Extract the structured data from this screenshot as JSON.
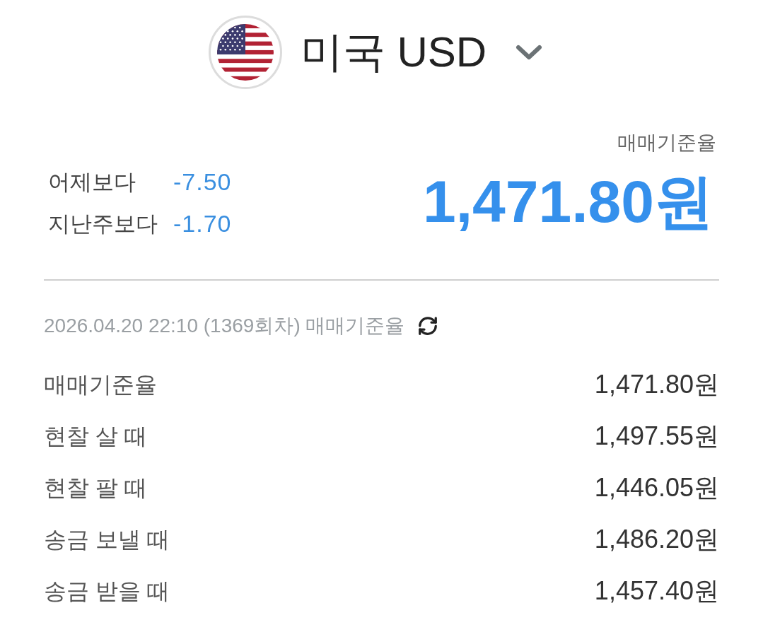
{
  "header": {
    "title": "미국 USD"
  },
  "summary": {
    "label": "매매기준율",
    "rate": "1,471.80원",
    "changes": [
      {
        "label": "어제보다",
        "value": "-7.50"
      },
      {
        "label": "지난주보다",
        "value": "-1.70"
      }
    ]
  },
  "timestamp": "2026.04.20 22:10 (1369회차) 매매기준율",
  "rates": [
    {
      "label": "매매기준율",
      "value": "1,471.80원"
    },
    {
      "label": "현찰 살 때",
      "value": "1,497.55원"
    },
    {
      "label": "현찰 팔 때",
      "value": "1,446.05원"
    },
    {
      "label": "송금 보낼 때",
      "value": "1,486.20원"
    },
    {
      "label": "송금 받을 때",
      "value": "1,457.40원"
    }
  ]
}
